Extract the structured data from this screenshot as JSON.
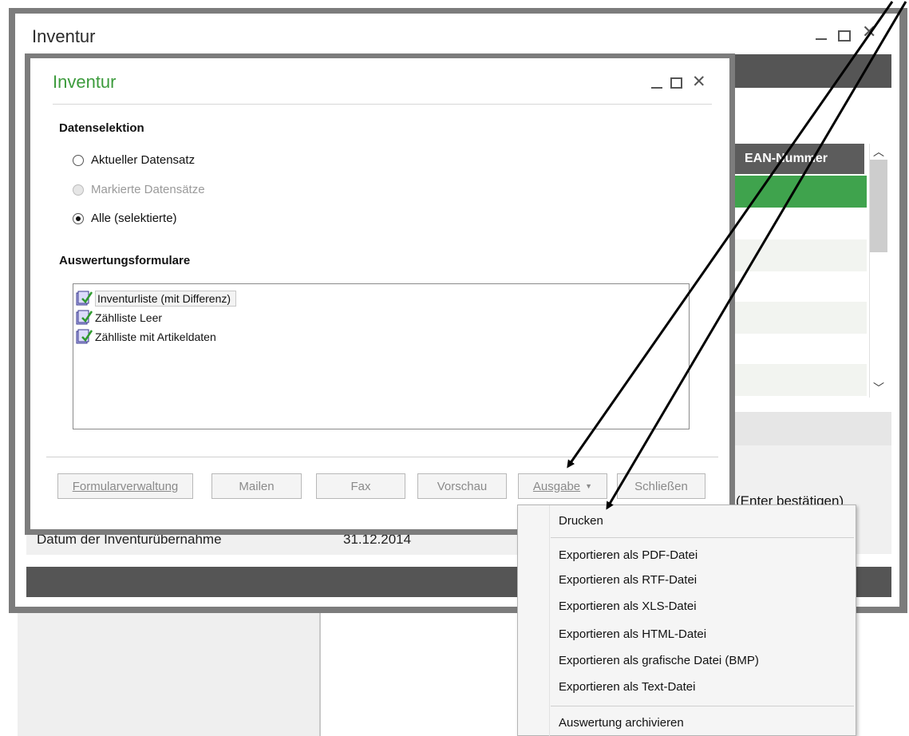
{
  "outer_window": {
    "title": "Inventur",
    "table_header": "EAN-Nummer",
    "hint": "(Enter bestätigen)",
    "inventory_date_label": "Datum der Inventurübernahme",
    "inventory_date_value": "31.12.2014"
  },
  "dialog": {
    "title": "Inventur",
    "data_selection": {
      "heading": "Datenselektion",
      "options": [
        {
          "label": "Aktueller Datensatz",
          "state": "unchecked"
        },
        {
          "label": "Markierte Datensätze",
          "state": "disabled"
        },
        {
          "label": "Alle (selektierte)",
          "state": "checked"
        }
      ]
    },
    "forms": {
      "heading": "Auswertungsformulare",
      "items": [
        {
          "label": "Inventurliste (mit Differenz)",
          "selected": true
        },
        {
          "label": "Zählliste Leer",
          "selected": false
        },
        {
          "label": "Zählliste mit Artikeldaten",
          "selected": false
        }
      ]
    },
    "buttons": {
      "form_management": "Formularverwaltung",
      "mail": "Mailen",
      "fax": "Fax",
      "preview": "Vorschau",
      "output": "Ausgabe",
      "close": "Schließen"
    }
  },
  "output_menu": {
    "items": [
      "Drucken",
      "Exportieren als PDF-Datei",
      "Exportieren als RTF-Datei",
      "Exportieren als XLS-Datei",
      "Exportieren als HTML-Datei",
      "Exportieren als grafische Datei (BMP)",
      "Exportieren als Text-Datei",
      "Auswertung archivieren"
    ]
  },
  "icons": {
    "minimize": "minimize-icon",
    "maximize": "maximize-icon",
    "close": "close-icon",
    "form": "form-document-icon",
    "dropdown": "chevron-down-icon"
  },
  "colors": {
    "accent_green": "#3fa34d",
    "dialog_title": "#3c9b3c",
    "dark_bar": "#555555"
  }
}
